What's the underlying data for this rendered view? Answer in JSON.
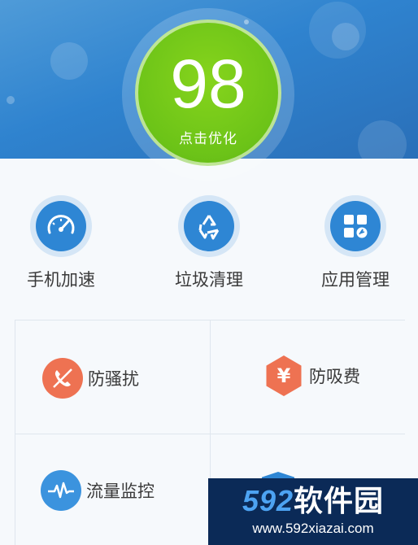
{
  "score": {
    "value": "98",
    "label": "点击优化"
  },
  "tools": [
    {
      "label": "手机加速",
      "icon": "speedometer-icon"
    },
    {
      "label": "垃圾清理",
      "icon": "recycle-icon"
    },
    {
      "label": "应用管理",
      "icon": "apps-grid-icon"
    }
  ],
  "features": [
    {
      "label": "防骚扰",
      "icon": "blocked-phone-icon",
      "color": "#ee7252"
    },
    {
      "label": "防吸费",
      "icon": "yuan-icon",
      "color": "#ee7252"
    },
    {
      "label": "流量监控",
      "icon": "pulse-icon",
      "color": "#3b93de"
    },
    {
      "label": "",
      "icon": "shield-icon",
      "color": "#2e86d4"
    }
  ],
  "watermark": {
    "brand_num": "592",
    "brand_cn": "软件园",
    "url": "www.592xiazai.com"
  },
  "colors": {
    "header": "#2f83cf",
    "score_green": "#6cc318",
    "tool_blue": "#2e86d4",
    "accent_red": "#ee7252"
  }
}
